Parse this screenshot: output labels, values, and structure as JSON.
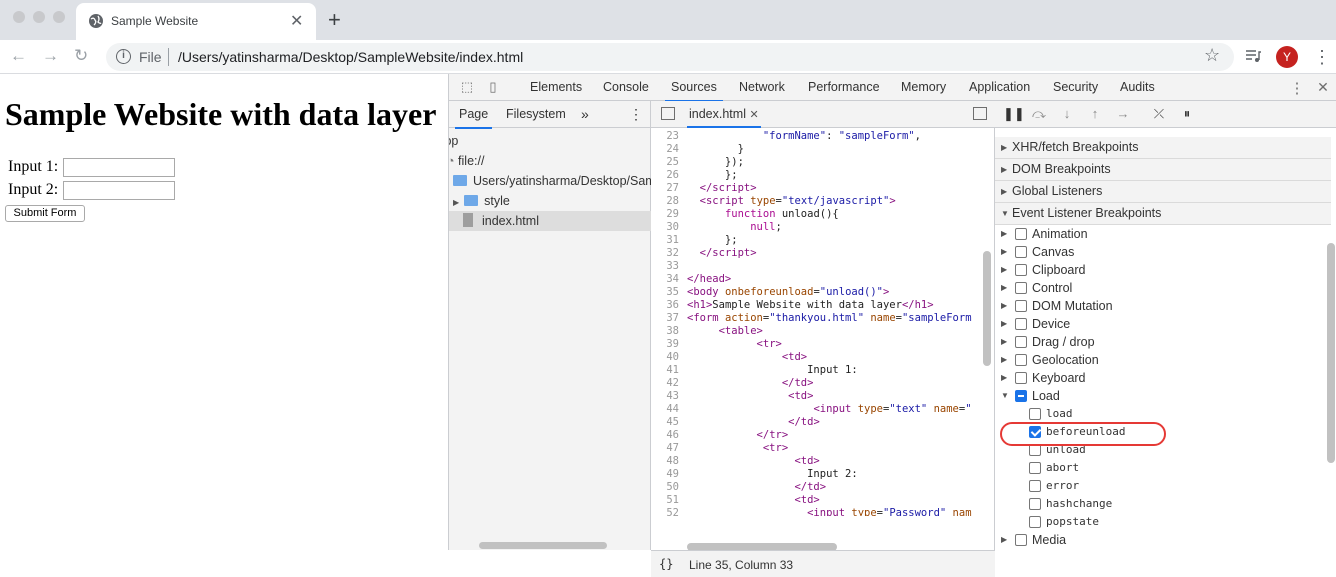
{
  "browser": {
    "tab_title": "Sample Website",
    "url_scheme": "File",
    "url": "/Users/yatinsharma/Desktop/SampleWebsite/index.html",
    "avatar_initial": "Y",
    "avatar_color": "#c5221f"
  },
  "page": {
    "heading": "Sample Website with data layer",
    "input1_label": "Input 1:",
    "input2_label": "Input 2:",
    "submit_label": "Submit Form"
  },
  "devtools": {
    "tabs": [
      "Elements",
      "Console",
      "Sources",
      "Network",
      "Performance",
      "Memory",
      "Application",
      "Security",
      "Audits"
    ],
    "active_tab": "Sources",
    "accent_color": "#1a73e8"
  },
  "navigator": {
    "tabs": [
      "Page",
      "Filesystem"
    ],
    "tree": [
      "top",
      "file://",
      "Users/yatinsharma/Desktop/Samp",
      "style",
      "index.html"
    ]
  },
  "editor": {
    "tab": "index.html",
    "status": "Line 35, Column 33",
    "lines": [
      {
        "n": "23",
        "html": "            <span class='str'>\"formName\"</span>: <span class='str'>\"sampleForm\"</span>,"
      },
      {
        "n": "24",
        "html": "        }"
      },
      {
        "n": "25",
        "html": "      });"
      },
      {
        "n": "26",
        "html": "      };"
      },
      {
        "n": "27",
        "html": "  <span class='tag'>&lt;/script&gt;</span>"
      },
      {
        "n": "28",
        "html": "  <span class='tag'>&lt;script</span> <span class='attr'>type</span>=<span class='str'>\"text/javascript\"</span><span class='tag'>&gt;</span>"
      },
      {
        "n": "29",
        "html": "      <span class='kw'>function</span> unload(){"
      },
      {
        "n": "30",
        "html": "          <span class='kw'>null</span>;"
      },
      {
        "n": "31",
        "html": "      };"
      },
      {
        "n": "32",
        "html": "  <span class='tag'>&lt;/script&gt;</span>"
      },
      {
        "n": "33",
        "html": ""
      },
      {
        "n": "34",
        "html": "<span class='tag'>&lt;/head&gt;</span>"
      },
      {
        "n": "35",
        "html": "<span class='tag'>&lt;body</span> <span class='attr'>onbeforeunload</span>=<span class='str'>\"unload()\"</span><span class='tag'>&gt;</span>"
      },
      {
        "n": "36",
        "html": "<span class='tag'>&lt;h1&gt;</span>Sample Website with data layer<span class='tag'>&lt;/h1&gt;</span>"
      },
      {
        "n": "37",
        "html": "<span class='tag'>&lt;form</span> <span class='attr'>action</span>=<span class='str'>\"thankyou.html\"</span> <span class='attr'>name</span>=<span class='str'>\"sampleForm</span>"
      },
      {
        "n": "38",
        "html": "     <span class='tag'>&lt;table&gt;</span>"
      },
      {
        "n": "39",
        "html": "           <span class='tag'>&lt;tr&gt;</span>"
      },
      {
        "n": "40",
        "html": "               <span class='tag'>&lt;td&gt;</span>"
      },
      {
        "n": "41",
        "html": "                   Input 1:"
      },
      {
        "n": "42",
        "html": "               <span class='tag'>&lt;/td&gt;</span>"
      },
      {
        "n": "43",
        "html": "                <span class='tag'>&lt;td&gt;</span>"
      },
      {
        "n": "44",
        "html": "                    <span class='tag'>&lt;input</span> <span class='attr'>type</span>=<span class='str'>\"text\"</span> <span class='attr'>name</span>=<span class='str'>\"</span>"
      },
      {
        "n": "45",
        "html": "                <span class='tag'>&lt;/td&gt;</span>"
      },
      {
        "n": "46",
        "html": "           <span class='tag'>&lt;/tr&gt;</span>"
      },
      {
        "n": "47",
        "html": "            <span class='tag'>&lt;tr&gt;</span>"
      },
      {
        "n": "48",
        "html": "                 <span class='tag'>&lt;td&gt;</span>"
      },
      {
        "n": "49",
        "html": "                   Input 2:"
      },
      {
        "n": "50",
        "html": "                 <span class='tag'>&lt;/td&gt;</span>"
      },
      {
        "n": "51",
        "html": "                 <span class='tag'>&lt;td&gt;</span>"
      },
      {
        "n": "52",
        "html": "                   <span class='tag'>&lt;input</span> <span class='attr'>type</span>=<span class='str'>\"Password\"</span> <span class='attr'>nam</span>"
      },
      {
        "n": "53",
        "html": ""
      }
    ]
  },
  "debugger": {
    "sections": [
      "XHR/fetch Breakpoints",
      "DOM Breakpoints",
      "Global Listeners",
      "Event Listener Breakpoints"
    ],
    "categories": [
      "Animation",
      "Canvas",
      "Clipboard",
      "Control",
      "DOM Mutation",
      "Device",
      "Drag / drop",
      "Geolocation",
      "Keyboard"
    ],
    "load_category": "Load",
    "load_events": [
      {
        "name": "load",
        "checked": false
      },
      {
        "name": "beforeunload",
        "checked": true
      },
      {
        "name": "unload",
        "checked": false
      },
      {
        "name": "abort",
        "checked": false
      },
      {
        "name": "error",
        "checked": false
      },
      {
        "name": "hashchange",
        "checked": false
      },
      {
        "name": "popstate",
        "checked": false
      }
    ],
    "last_category": "Media",
    "highlight_color": "#e53935"
  }
}
